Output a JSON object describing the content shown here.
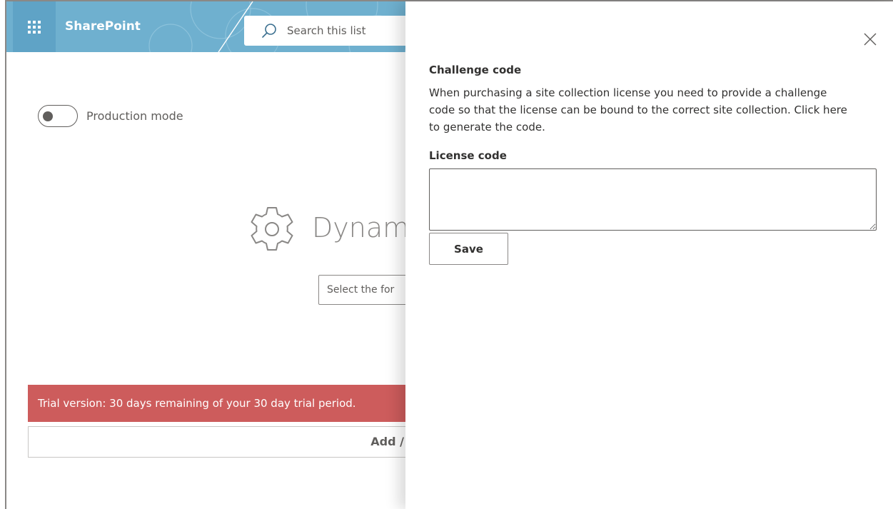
{
  "suite_bar": {
    "brand": "SharePoint",
    "search_placeholder": "Search this list"
  },
  "page": {
    "toggle_label": "Production mode",
    "toggle_state": "off",
    "hero_title": "Dynamic",
    "select_placeholder": "Select the for",
    "trial_message": "Trial version: 30 days remaining of your 30 day trial period.",
    "add_bar_label": "Add /"
  },
  "panel": {
    "challenge_title": "Challenge code",
    "challenge_description": "When purchasing a site collection license you need to provide a challenge code so that the license can be bound to the correct site collection. Click here to generate the code.",
    "license_title": "License code",
    "license_value": "",
    "save_label": "Save"
  },
  "colors": {
    "suite_bar": "#6fb0cf",
    "trial_bar": "#cd5c5c",
    "panel_text": "#323130"
  },
  "icons": [
    "waffle-icon",
    "search-icon",
    "gear-icon",
    "close-icon"
  ]
}
